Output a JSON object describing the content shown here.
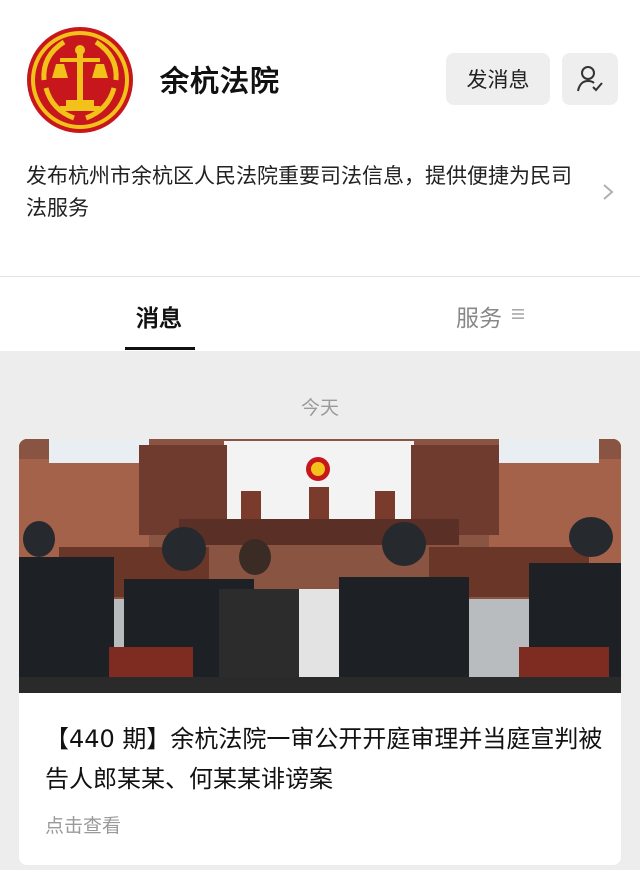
{
  "account": {
    "name": "余杭法院",
    "send_message_label": "发消息",
    "description": "发布杭州市余杭区人民法院重要司法信息，提供便捷为民司法服务"
  },
  "tabs": {
    "messages_label": "消息",
    "services_label": "服务"
  },
  "feed": {
    "date_label": "今天",
    "article": {
      "title": "【440 期】余杭法院一审公开开庭审理并当庭宣判被告人郎某某、何某某诽谤案",
      "action_label": "点击查看"
    }
  },
  "colors": {
    "emblem_red": "#c8161d",
    "emblem_gold": "#f2c21b",
    "background": "#ededed"
  },
  "icons": {
    "logo": "court-emblem",
    "follow": "person-check-icon",
    "chevron": "chevron-right-icon",
    "menu": "menu-icon"
  }
}
